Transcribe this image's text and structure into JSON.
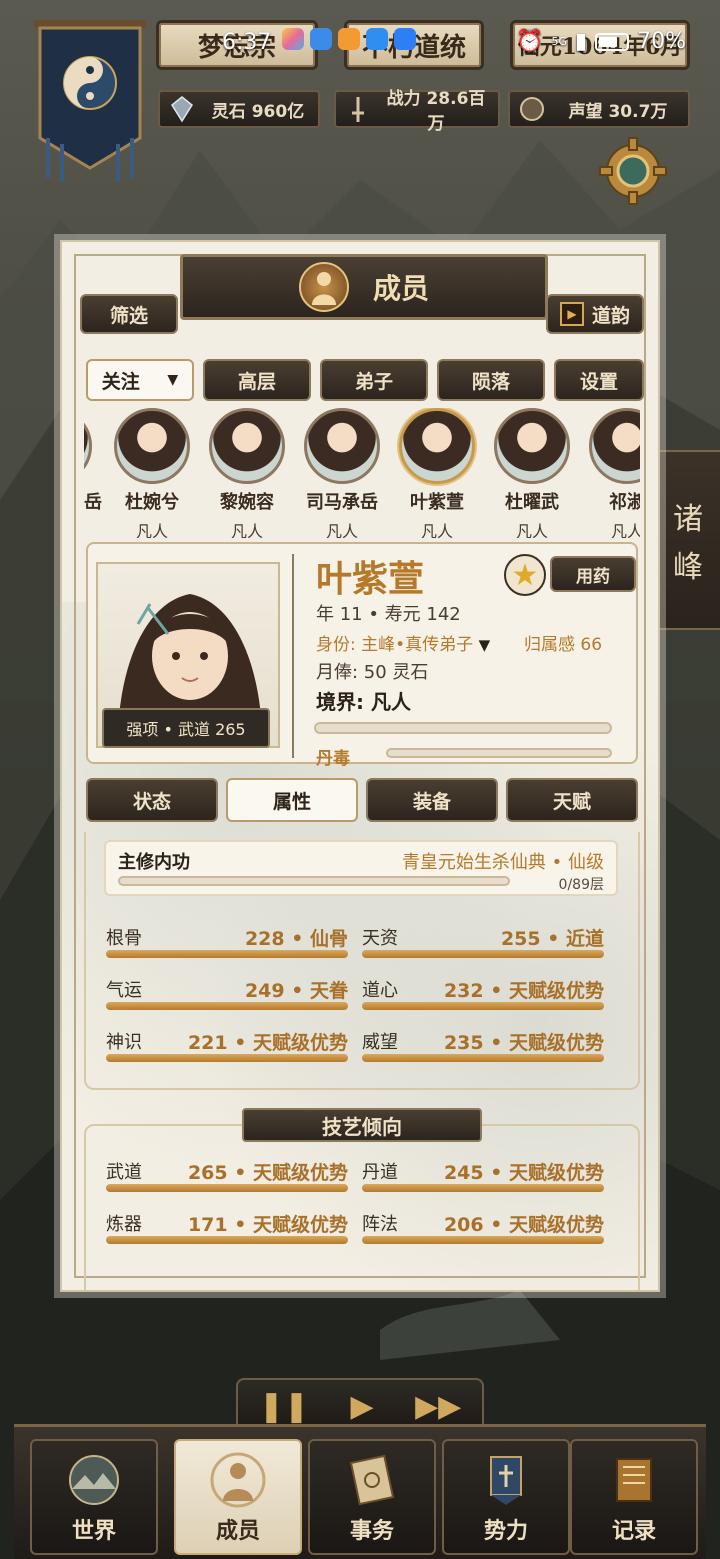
{
  "status_bar": {
    "time": "6:37",
    "battery": "70%",
    "signal_label": "5G"
  },
  "top": {
    "sect_name": "梦忘宗",
    "lineage": "不朽道统",
    "year": "仙元1064年6月",
    "spirit_stone": "灵石 960亿",
    "combat_power": "战力 28.6百万",
    "reputation": "声望 30.7万"
  },
  "side_tab": {
    "line1": "诸",
    "line2": "峰"
  },
  "panel": {
    "title": "成员",
    "filter_label": "筛选",
    "daoyun_label": "道韵",
    "follow_select": "关注",
    "tabs": [
      "高层",
      "弟子",
      "陨落",
      "设置"
    ]
  },
  "members": [
    {
      "name": "岳",
      "rank": ""
    },
    {
      "name": "杜婉兮",
      "rank": "凡人"
    },
    {
      "name": "黎婉容",
      "rank": "凡人"
    },
    {
      "name": "司马承岳",
      "rank": "凡人"
    },
    {
      "name": "叶紫萱",
      "rank": "凡人"
    },
    {
      "name": "杜曜武",
      "rank": "凡人"
    },
    {
      "name": "祁淑",
      "rank": "凡人"
    }
  ],
  "character": {
    "name": "叶紫萱",
    "strength": "强项 • 武道 265",
    "medicine_button": "用药",
    "age_line": "年 11 • 寿元 142",
    "identity": "身份: 主峰•真传弟子",
    "belonging": "归属感 66",
    "salary": "月俸: 50 灵石",
    "realm": "境界: 凡人",
    "poison_label": "丹毒",
    "exp_progress": 0,
    "poison_progress": 0
  },
  "detail_tabs": [
    "状态",
    "属性",
    "装备",
    "天赋"
  ],
  "cultivation": {
    "label": "主修内功",
    "technique": "青皇元始生杀仙典 • 仙级",
    "layers": "0/89层",
    "progress": 0
  },
  "attributes": [
    {
      "label": "根骨",
      "value": "228 • 仙骨"
    },
    {
      "label": "天资",
      "value": "255 • 近道"
    },
    {
      "label": "气运",
      "value": "249 • 天眷"
    },
    {
      "label": "道心",
      "value": "232 • 天赋级优势"
    },
    {
      "label": "神识",
      "value": "221 • 天赋级优势"
    },
    {
      "label": "威望",
      "value": "235 • 天赋级优势"
    }
  ],
  "skills_title": "技艺倾向",
  "skills": [
    {
      "label": "武道",
      "value": "265 • 天赋级优势"
    },
    {
      "label": "丹道",
      "value": "245 • 天赋级优势"
    },
    {
      "label": "炼器",
      "value": "171 • 天赋级优势"
    },
    {
      "label": "阵法",
      "value": "206 • 天赋级优势"
    }
  ],
  "nav": [
    "世界",
    "成员",
    "事务",
    "势力",
    "记录"
  ],
  "colors": {
    "accent_gold": "#b57a2c",
    "panel_bg": "#f3eee3",
    "dark_frame": "#2c251e"
  }
}
